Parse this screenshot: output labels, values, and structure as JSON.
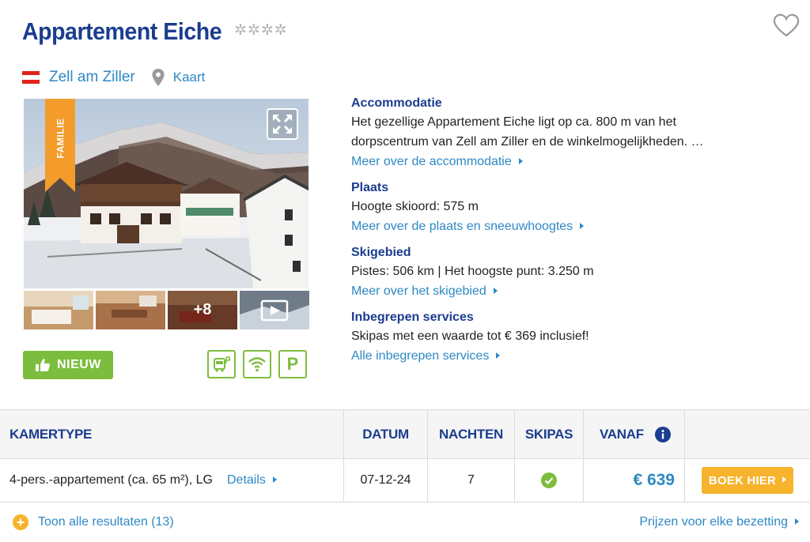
{
  "header": {
    "title": "Appartement Eiche",
    "stars": "✲✲✲✲",
    "favorite_icon": "heart-icon"
  },
  "location": {
    "flag": "austria-flag",
    "flag_colors": [
      "#e2231a",
      "#ffffff",
      "#e2231a"
    ],
    "name": "Zell am Ziller",
    "map_label": "Kaart"
  },
  "gallery": {
    "ribbon_label": "FAMILIE",
    "ribbon_color": "#f39c2b",
    "more_label": "+8",
    "expand_icon": "expand-icon",
    "video_icon": "play-video-icon"
  },
  "badges": {
    "new_label": "NIEUW",
    "amenities": [
      "bus-stop-icon",
      "wifi-icon",
      "parking-icon"
    ],
    "parking_label": "P"
  },
  "sections": [
    {
      "title": "Accommodatie",
      "text": [
        "Het gezellige Appartement Eiche ligt op ca. 800 m van het",
        "dorpscentrum van Zell am Ziller en de winkelmogelijkheden. …"
      ],
      "link": "Meer over de accommodatie"
    },
    {
      "title": "Plaats",
      "text": [
        "Hoogte skioord: 575 m"
      ],
      "link": "Meer over de plaats en sneeuwhoogtes"
    },
    {
      "title": "Skigebied",
      "text": [
        "Pistes: 506 km | Het hoogste punt: 3.250 m"
      ],
      "link": "Meer over het skigebied"
    },
    {
      "title": "Inbegrepen services",
      "text": [
        "Skipas met een waarde tot € 369 inclusief!"
      ],
      "link": "Alle inbegrepen services"
    }
  ],
  "table": {
    "headers": {
      "room_type": "KAMERTYPE",
      "date": "DATUM",
      "nights": "NACHTEN",
      "skipass": "SKIPAS",
      "from": "VANAF"
    },
    "rows": [
      {
        "room": "4-pers.-appartement (ca. 65 m²), LG",
        "details": "Details",
        "date": "07-12-24",
        "nights": "7",
        "skipass_included": true,
        "price": "€ 639",
        "book": "BOEK HIER"
      }
    ]
  },
  "footer": {
    "show_all": "Toon alle resultaten (13)",
    "prices_link": "Prijzen voor elke bezetting"
  },
  "colors": {
    "brand_blue": "#1b3d8f",
    "link_blue": "#2e88c5",
    "green": "#7dbd3e",
    "orange": "#f7b32b"
  }
}
